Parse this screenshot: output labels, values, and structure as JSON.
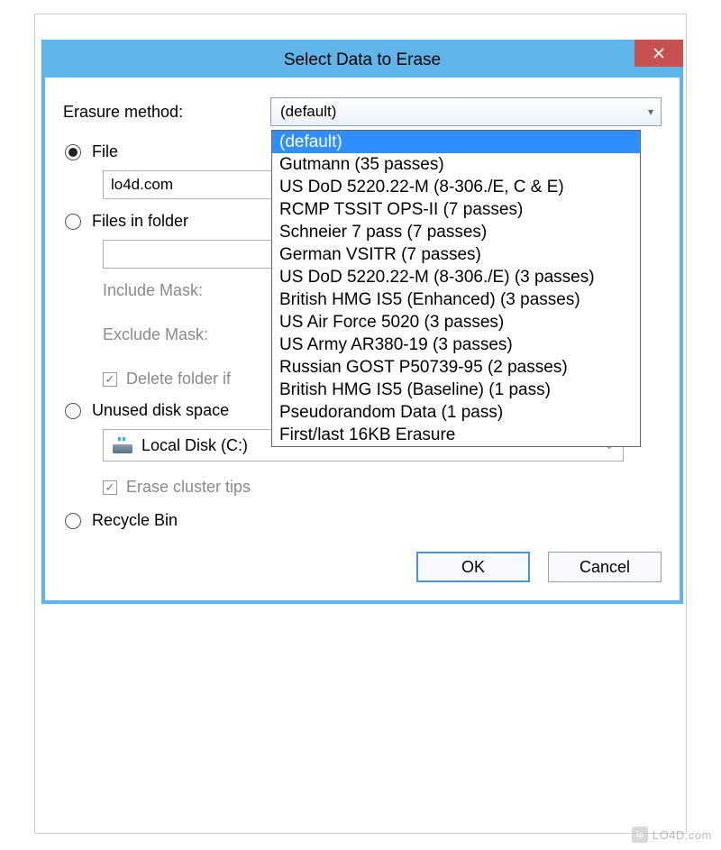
{
  "dialog": {
    "title": "Select Data to Erase",
    "erasure_label": "Erasure method:",
    "erasure_value": "(default)",
    "erasure_options": [
      "(default)",
      "Gutmann (35 passes)",
      "US DoD 5220.22-M (8-306./E, C & E)",
      "RCMP TSSIT OPS-II (7 passes)",
      "Schneier 7 pass (7 passes)",
      "German VSITR (7 passes)",
      "US DoD 5220.22-M (8-306./E) (3 passes)",
      "British HMG IS5 (Enhanced) (3 passes)",
      "US Air Force 5020 (3 passes)",
      "US Army AR380-19 (3 passes)",
      "Russian GOST P50739-95 (2 passes)",
      "British HMG IS5 (Baseline) (1 pass)",
      "Pseudorandom Data (1 pass)",
      "First/last 16KB Erasure"
    ],
    "radios": {
      "file": "File",
      "files_in_folder": "Files in folder",
      "unused": "Unused disk space",
      "recycle": "Recycle Bin"
    },
    "file_value": "lo4d.com",
    "include_mask": "Include Mask:",
    "exclude_mask": "Exclude Mask:",
    "delete_folder_if": "Delete folder if",
    "disk_value": "Local Disk (C:)",
    "erase_cluster_tips": "Erase cluster tips",
    "buttons": {
      "ok": "OK",
      "cancel": "Cancel"
    }
  },
  "watermark": "LO4D.com"
}
